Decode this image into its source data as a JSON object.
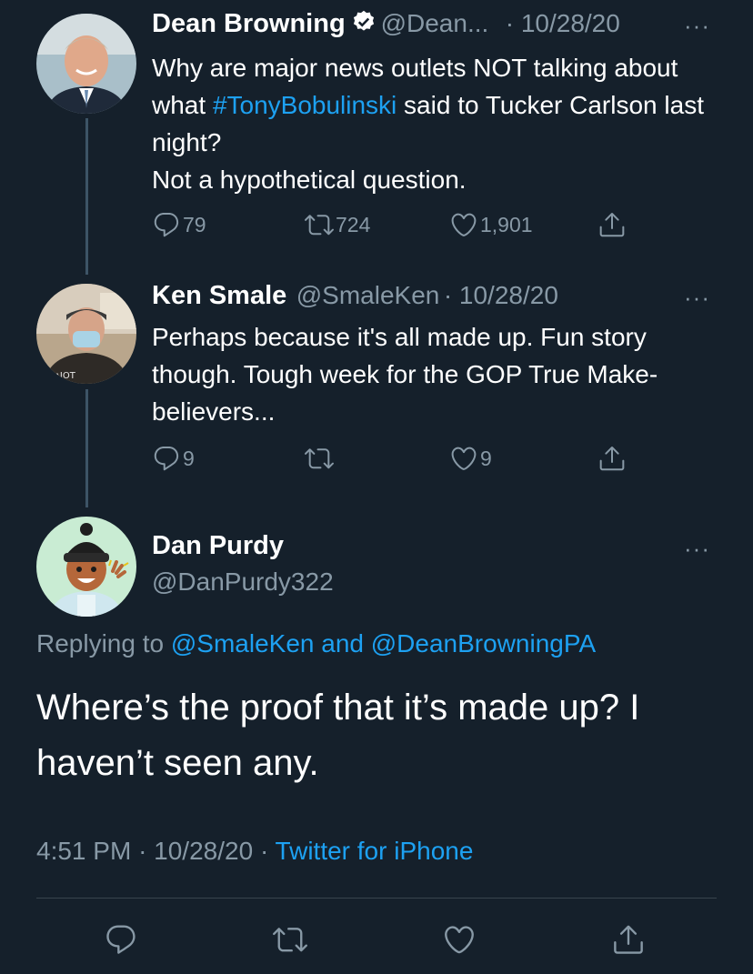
{
  "tweet1": {
    "name": "Dean Browning",
    "handle": "@Dean...",
    "date": "· 10/28/20",
    "more": "···",
    "text_before": "Why are major news outlets NOT talking about what ",
    "hashtag": "#TonyBobulinski",
    "text_after": " said to Tucker Carlson last night?",
    "text_line2": "Not a hypothetical question.",
    "replies": "79",
    "retweets": "724",
    "likes": "1,901"
  },
  "tweet2": {
    "name": "Ken Smale",
    "handle": "@SmaleKen",
    "date": "· 10/28/20",
    "more": "···",
    "text": "Perhaps because it's all made up. Fun story though. Tough week for the GOP True Make-believers...",
    "replies": "9",
    "retweets": "",
    "likes": "9"
  },
  "main_tweet": {
    "name": "Dan Purdy",
    "handle": "@DanPurdy322",
    "more": "···",
    "replying_prefix": "Replying to ",
    "replying_to": "@SmaleKen and @DeanBrowningPA",
    "text": "Where’s the proof that it’s made up? I haven’t seen any.",
    "time": "4:51 PM",
    "date": "· 10/28/20 ·",
    "source": "Twitter for iPhone"
  },
  "icons": {
    "reply": "reply-icon",
    "retweet": "retweet-icon",
    "like": "heart-icon",
    "share": "share-icon",
    "verified": "verified-badge-icon"
  },
  "colors": {
    "background": "#15202b",
    "link": "#1da1f2",
    "muted": "#8899a6"
  }
}
